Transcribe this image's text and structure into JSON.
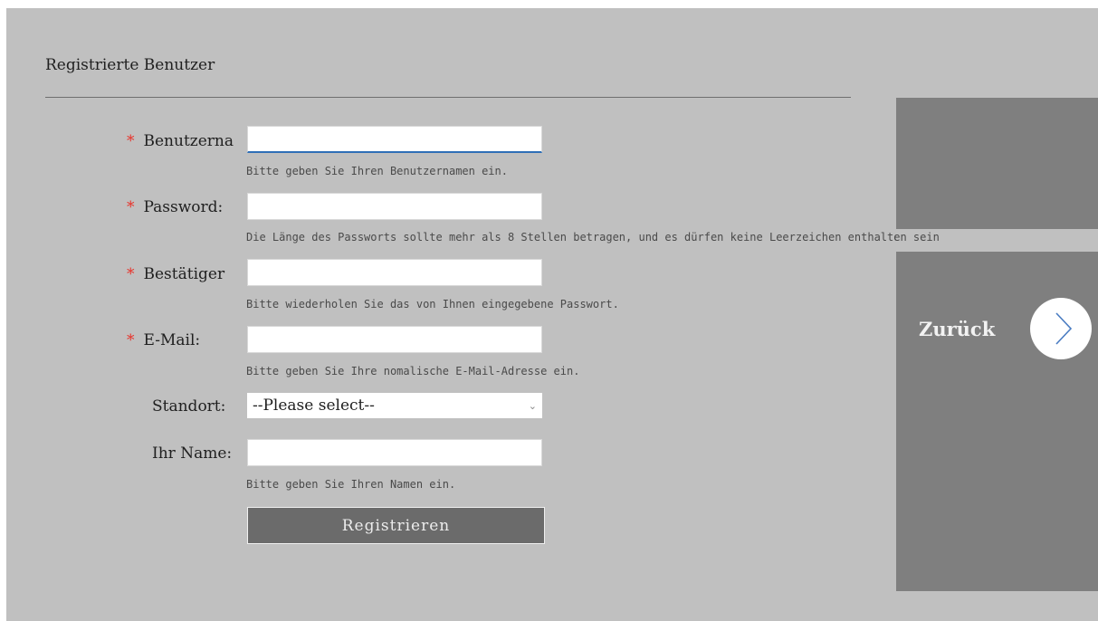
{
  "page": {
    "title": "Registrierte Benutzer"
  },
  "form": {
    "required_mark": "*",
    "username": {
      "label": "Benutzerna",
      "value": "",
      "hint": "Bitte geben Sie Ihren Benutzernamen ein."
    },
    "password": {
      "label": "Password:",
      "value": "",
      "hint": "Die Länge des Passworts sollte mehr als 8 Stellen betragen, und es dürfen keine Leerzeichen enthalten sein"
    },
    "confirm": {
      "label": "Bestätiger",
      "value": "",
      "hint": "Bitte wiederholen Sie das von Ihnen eingegebene Passwort."
    },
    "email": {
      "label": "E-Mail:",
      "value": "",
      "hint": "Bitte geben Sie Ihre nomalische E-Mail-Adresse ein."
    },
    "location": {
      "label": "Standort:",
      "selected": "--Please select--"
    },
    "name": {
      "label": "Ihr Name:",
      "value": "",
      "hint": "Bitte geben Sie Ihren Namen ein."
    },
    "submit_label": "Registrieren"
  },
  "side": {
    "back_label": "Zurück",
    "back_icon": "chevron-right-icon"
  },
  "colors": {
    "background": "#c0c0c0",
    "side_panel": "#7f7f7f",
    "button": "#6b6b6b",
    "required": "#e8332b",
    "focus": "#2f6fb7"
  }
}
